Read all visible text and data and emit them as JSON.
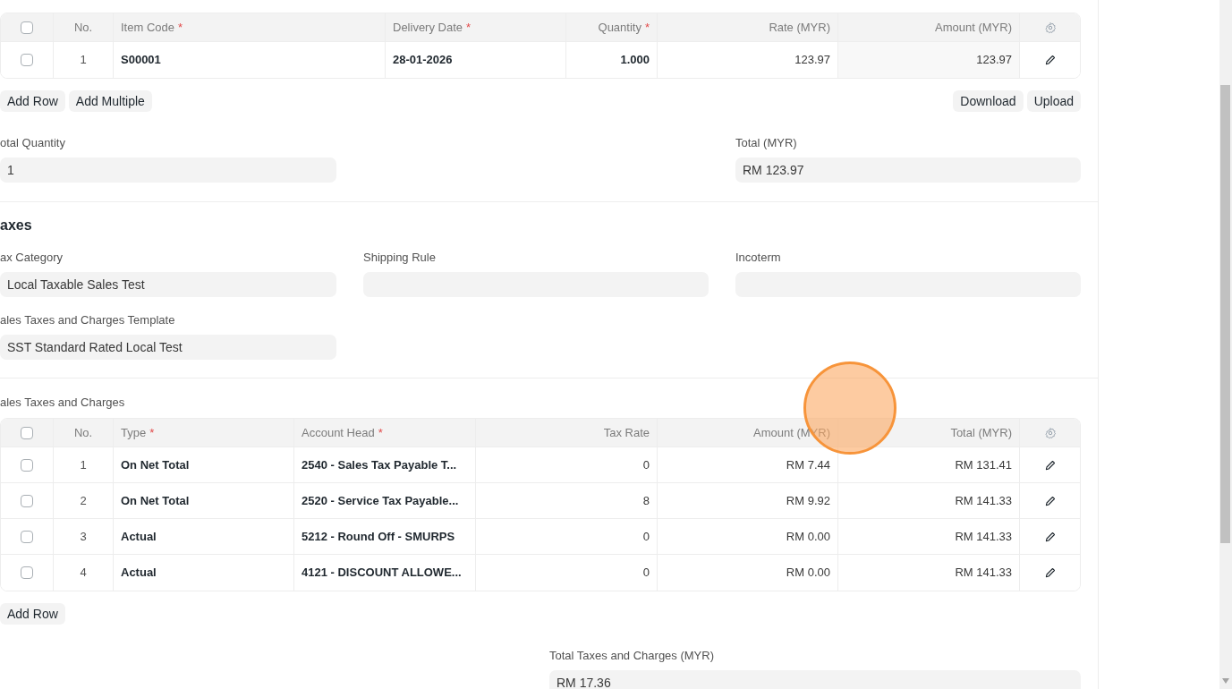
{
  "items_table": {
    "all_selected": false,
    "columns": [
      {
        "label": "No."
      },
      {
        "label": "Item Code",
        "required_mark": "*"
      },
      {
        "label": "Delivery Date",
        "required_mark": "*"
      },
      {
        "label": "Quantity",
        "required_mark": "*"
      },
      {
        "label": "Rate (MYR)"
      },
      {
        "label": "Amount (MYR)"
      }
    ],
    "rows": [
      {
        "selected": false,
        "cells": [
          "1",
          "S00001",
          "28-01-2026",
          "1.000",
          "123.97",
          "123.97"
        ]
      }
    ],
    "buttons_left": [
      "Add Row",
      "Add Multiple"
    ],
    "buttons_right": [
      "Download",
      "Upload"
    ]
  },
  "totals": [
    {
      "label": "otal Quantity",
      "value": "1"
    },
    {
      "label": "Total (MYR)",
      "value": "RM 123.97"
    }
  ],
  "taxes_section": {
    "heading": "axes",
    "fields": [
      {
        "label": "ax Category",
        "value": "Local Taxable Sales Test"
      },
      {
        "label": "Shipping Rule"
      },
      {
        "label": "Incoterm"
      },
      {
        "label": "ales Taxes and Charges Template",
        "value": "SST Standard Rated Local Test"
      }
    ]
  },
  "tax_table": {
    "label": "ales Taxes and Charges",
    "all_selected": false,
    "columns": [
      {
        "label": "No."
      },
      {
        "label": "Type",
        "required_mark": "*"
      },
      {
        "label": "Account Head",
        "required_mark": "*"
      },
      {
        "label": "Tax Rate"
      },
      {
        "label": "Amount (MYR)"
      },
      {
        "label": "Total (MYR)"
      }
    ],
    "rows": [
      {
        "selected": false,
        "cells": [
          "1",
          "On Net Total",
          "2540 - Sales Tax Payable T...",
          "0",
          "RM 7.44",
          "RM 131.41"
        ]
      },
      {
        "selected": false,
        "cells": [
          "2",
          "On Net Total",
          "2520 - Service Tax Payable...",
          "8",
          "RM 9.92",
          "RM 141.33"
        ]
      },
      {
        "selected": false,
        "cells": [
          "3",
          "Actual",
          "5212 - Round Off - SMURPS",
          "0",
          "RM 0.00",
          "RM 141.33"
        ]
      },
      {
        "selected": false,
        "cells": [
          "4",
          "Actual",
          "4121 - DISCOUNT ALLOWE...",
          "0",
          "RM 0.00",
          "RM 141.33"
        ]
      }
    ],
    "buttons": [
      "Add Row"
    ]
  },
  "total_taxes": {
    "label": "Total Taxes and Charges (MYR)",
    "value": "RM 17.36"
  }
}
